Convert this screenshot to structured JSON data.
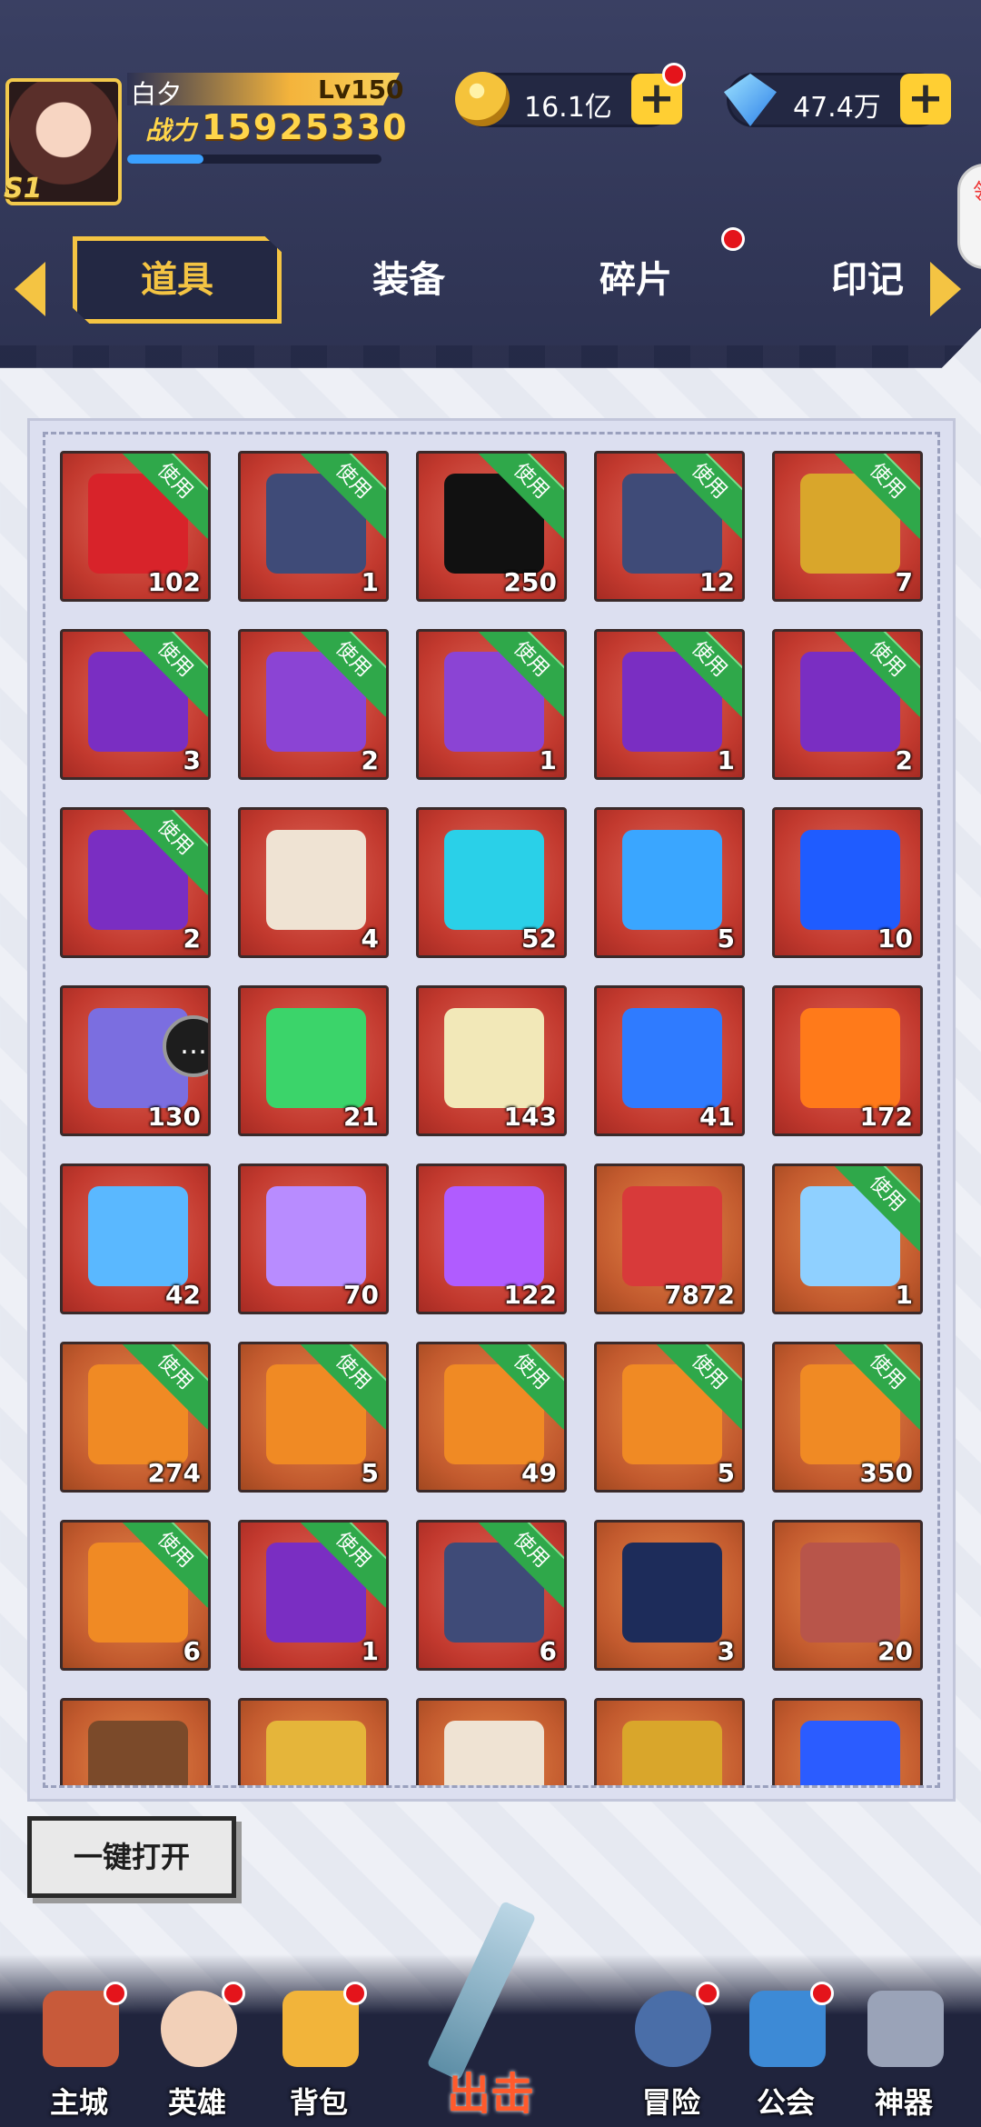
{
  "player": {
    "name": "白夕",
    "level": "Lv150",
    "power_label": "战力",
    "power_value": "15925330",
    "season_badge": "S1"
  },
  "currency": {
    "gold": "16.1亿",
    "diamonds": "47.4万"
  },
  "side_bubble": "领",
  "tabs": [
    {
      "label": "道具",
      "active": true
    },
    {
      "label": "装备",
      "active": false
    },
    {
      "label": "碎片",
      "active": false
    },
    {
      "label": "印记",
      "active": false
    }
  ],
  "use_label": "使用",
  "items": [
    {
      "name": "red-bag",
      "count": "102",
      "use": true,
      "tone": "red",
      "color": "#d8232a"
    },
    {
      "name": "hero-card-pack",
      "count": "1",
      "use": true,
      "tone": "red",
      "color": "#3f4b78"
    },
    {
      "name": "mystery-hero",
      "count": "250",
      "use": true,
      "tone": "red",
      "color": "#111111"
    },
    {
      "name": "hero-card-pack",
      "count": "12",
      "use": true,
      "tone": "red",
      "color": "#3f4b78"
    },
    {
      "name": "gold-card-pack",
      "count": "7",
      "use": true,
      "tone": "red",
      "color": "#d9a62b"
    },
    {
      "name": "purple-card-pack",
      "count": "3",
      "use": true,
      "tone": "red",
      "color": "#7a2ec2"
    },
    {
      "name": "purple-card-pack-glow",
      "count": "2",
      "use": true,
      "tone": "red",
      "color": "#8b44d4"
    },
    {
      "name": "purple-card-pack-glow",
      "count": "1",
      "use": true,
      "tone": "red",
      "color": "#8b44d4"
    },
    {
      "name": "purple-card-pack",
      "count": "1",
      "use": true,
      "tone": "red",
      "color": "#7a2ec2"
    },
    {
      "name": "purple-card-pack",
      "count": "2",
      "use": true,
      "tone": "red",
      "color": "#7a2ec2"
    },
    {
      "name": "purple-card-pack",
      "count": "2",
      "use": true,
      "tone": "red",
      "color": "#7a2ec2"
    },
    {
      "name": "contract-scroll",
      "count": "4",
      "use": false,
      "tone": "red",
      "color": "#efe3d3"
    },
    {
      "name": "gem-relic",
      "count": "52",
      "use": false,
      "tone": "red",
      "color": "#2ad0e8"
    },
    {
      "name": "star-ticket",
      "count": "5",
      "use": false,
      "tone": "red",
      "color": "#3aa6ff"
    },
    {
      "name": "blue-crystal",
      "count": "10",
      "use": false,
      "tone": "red",
      "color": "#1f5cff"
    },
    {
      "name": "purple-medal",
      "count": "130",
      "use": false,
      "tone": "red",
      "color": "#7b6ee0"
    },
    {
      "name": "green-chest",
      "count": "21",
      "use": false,
      "tone": "red",
      "color": "#3bd46a"
    },
    {
      "name": "flower-bouquet",
      "count": "143",
      "use": false,
      "tone": "red",
      "color": "#f2e8b8"
    },
    {
      "name": "blue-orb",
      "count": "41",
      "use": false,
      "tone": "red",
      "color": "#2f7bff"
    },
    {
      "name": "fire-orb",
      "count": "172",
      "use": false,
      "tone": "red",
      "color": "#ff7a1a"
    },
    {
      "name": "water-orb",
      "count": "42",
      "use": false,
      "tone": "red",
      "color": "#5ab8ff"
    },
    {
      "name": "star-sphere",
      "count": "70",
      "use": false,
      "tone": "red",
      "color": "#b88cff"
    },
    {
      "name": "purple-vortex",
      "count": "122",
      "use": false,
      "tone": "red",
      "color": "#b05cff"
    },
    {
      "name": "red-ticket",
      "count": "7872",
      "use": false,
      "tone": "orange",
      "color": "#d83a3a"
    },
    {
      "name": "hero-portrait",
      "count": "1",
      "use": true,
      "tone": "orange",
      "color": "#8fd0ff"
    },
    {
      "name": "orange-bag",
      "count": "274",
      "use": true,
      "tone": "orange",
      "color": "#f08a24"
    },
    {
      "name": "orange-bag",
      "count": "5",
      "use": true,
      "tone": "orange",
      "color": "#f08a24"
    },
    {
      "name": "orange-bag",
      "count": "49",
      "use": true,
      "tone": "orange",
      "color": "#f08a24"
    },
    {
      "name": "orange-bag",
      "count": "5",
      "use": true,
      "tone": "orange",
      "color": "#f08a24"
    },
    {
      "name": "orange-bag",
      "count": "350",
      "use": true,
      "tone": "orange",
      "color": "#f08a24"
    },
    {
      "name": "mark-bag",
      "count": "6",
      "use": true,
      "tone": "orange",
      "color": "#f08a24"
    },
    {
      "name": "chibi-card-pack",
      "count": "1",
      "use": true,
      "tone": "red",
      "color": "#7a2ec2"
    },
    {
      "name": "hero-card-pack",
      "count": "6",
      "use": true,
      "tone": "red",
      "color": "#3f4b78"
    },
    {
      "name": "compass-medal",
      "count": "3",
      "use": false,
      "tone": "orange",
      "color": "#1d2c5a"
    },
    {
      "name": "spiked-gauntlets",
      "count": "20",
      "use": false,
      "tone": "orange",
      "color": "#b8554a"
    },
    {
      "name": "chocolate",
      "count": "",
      "use": false,
      "tone": "orange",
      "color": "#7b4a2a"
    },
    {
      "name": "magnifier-key",
      "count": "",
      "use": false,
      "tone": "orange",
      "color": "#e5b53a"
    },
    {
      "name": "end-scroll",
      "count": "",
      "use": false,
      "tone": "orange",
      "color": "#efe3d3"
    },
    {
      "name": "gold-card",
      "count": "",
      "use": false,
      "tone": "orange",
      "color": "#d9a62b"
    },
    {
      "name": "blue-flame-orb",
      "count": "",
      "use": false,
      "tone": "orange",
      "color": "#2b5cff"
    }
  ],
  "open_all_label": "一键打开",
  "nav": [
    {
      "id": "main-city",
      "label": "主城",
      "icon_color": "#c85a3a",
      "dot": true
    },
    {
      "id": "heroes",
      "label": "英雄",
      "icon_color": "#f2d0b8",
      "dot": true
    },
    {
      "id": "backpack",
      "label": "背包",
      "icon_color": "#f2b43a",
      "dot": true
    },
    {
      "id": "adventure",
      "label": "冒险",
      "icon_color": "#4a6ea8",
      "dot": true
    },
    {
      "id": "guild",
      "label": "公会",
      "icon_color": "#3d8ad6",
      "dot": true
    },
    {
      "id": "artifact",
      "label": "神器",
      "icon_color": "#9aa3b8",
      "dot": false
    }
  ],
  "nav_center_label": "出击"
}
